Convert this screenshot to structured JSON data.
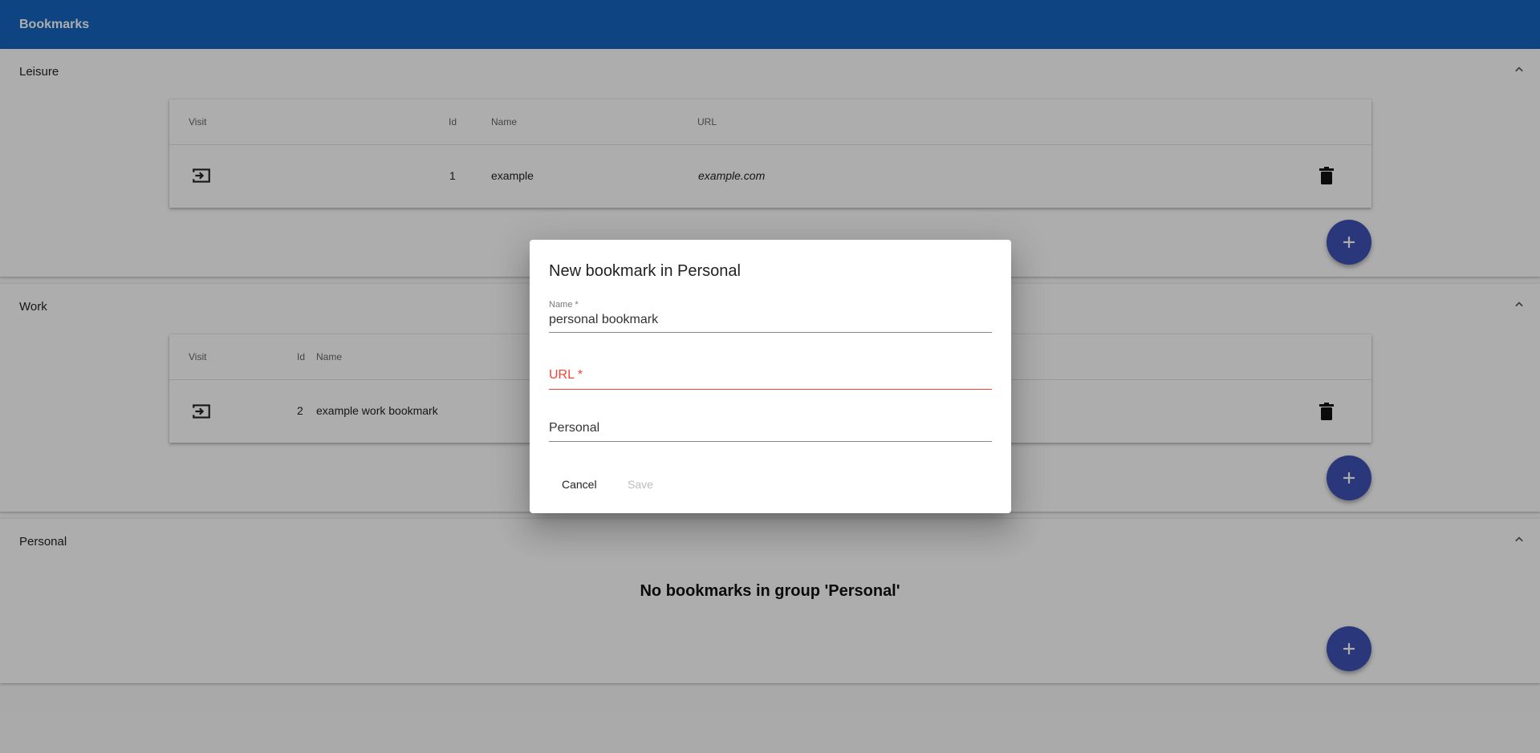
{
  "app": {
    "title": "Bookmarks"
  },
  "columns": {
    "visit": "Visit",
    "id": "Id",
    "name": "Name",
    "url": "URL"
  },
  "groups": [
    {
      "title": "Leisure",
      "rows": [
        {
          "id": "1",
          "name": "example",
          "url": "example.com"
        }
      ]
    },
    {
      "title": "Work",
      "rows": [
        {
          "id": "2",
          "name": "example work bookmark"
        }
      ]
    },
    {
      "title": "Personal",
      "empty_message": "No bookmarks in group 'Personal'"
    }
  ],
  "dialog": {
    "title": "New bookmark in Personal",
    "name_label": "Name *",
    "name_value": "personal bookmark",
    "url_label": "URL *",
    "group_value": "Personal",
    "cancel_label": "Cancel",
    "save_label": "Save"
  },
  "colors": {
    "appbar": "#1565c0",
    "fab": "#3f51b5",
    "error": "#f44336"
  },
  "icons": [
    "chevron-up-icon",
    "visit-icon",
    "delete-icon",
    "plus-icon"
  ]
}
